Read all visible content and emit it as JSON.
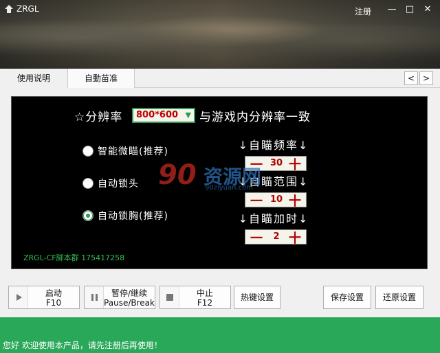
{
  "window": {
    "title": "ZRGL",
    "register_link": "注册",
    "controls": [
      "—",
      "□",
      "✕"
    ]
  },
  "tabs": [
    {
      "label": "使用说明",
      "active": false
    },
    {
      "label": "自動苗准",
      "active": true
    }
  ],
  "tab_scroll": {
    "left": "<",
    "right": ">"
  },
  "resolution": {
    "prefix": "☆分辨率",
    "value": "800*600",
    "suffix": "与游戏内分辨率一致"
  },
  "modes": [
    {
      "label": "智能微瞄(推荐)",
      "selected": false
    },
    {
      "label": "自动锁头",
      "selected": false
    },
    {
      "label": "自动锁胸(推荐)",
      "selected": true
    }
  ],
  "settings": [
    {
      "title": "↓自瞄频率↓",
      "value": "30"
    },
    {
      "title": "↓自瞄范围↓",
      "value": "10"
    },
    {
      "title": "↓自瞄加时↓",
      "value": "2"
    }
  ],
  "stepper_symbols": {
    "minus": "一",
    "plus": "十"
  },
  "group_text": "ZRGL-CF脚本群 175417258",
  "watermark": {
    "number": "90",
    "name": "资源网",
    "url": "90ziyuan.com"
  },
  "buttons": {
    "start": {
      "line1": "启动",
      "line2": "F10"
    },
    "pause": {
      "line1": "暂停/继续",
      "line2": "Pause/Break"
    },
    "stop": {
      "line1": "中止",
      "line2": "F12"
    },
    "hotkey": "热键设置",
    "save": "保存设置",
    "restore": "还原设置"
  },
  "status_text": "您好 欢迎使用本产品，请先注册后再使用！",
  "colors": {
    "accent": "#2aa85a",
    "value_red": "#c00000",
    "group_green": "#2fbf4f"
  }
}
